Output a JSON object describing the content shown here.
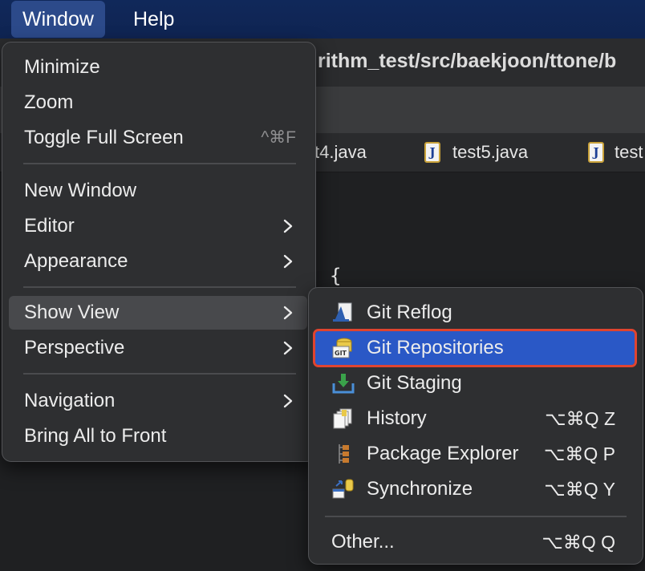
{
  "menubar": {
    "items": [
      {
        "label": "Window"
      },
      {
        "label": "Help"
      }
    ]
  },
  "editor": {
    "path_fragment": "rithm_test/src/baekjoon/ttone/b",
    "tabs": [
      {
        "label": "t4.java"
      },
      {
        "label": "test5.java"
      },
      {
        "label": "test"
      }
    ],
    "code_fragment": "{"
  },
  "window_menu": {
    "items": [
      {
        "label": "Minimize"
      },
      {
        "label": "Zoom"
      },
      {
        "label": "Toggle Full Screen",
        "shortcut": "^⌘F"
      },
      {
        "label": "New Window"
      },
      {
        "label": "Editor"
      },
      {
        "label": "Appearance"
      },
      {
        "label": "Show View"
      },
      {
        "label": "Perspective"
      },
      {
        "label": "Navigation"
      },
      {
        "label": "Bring All to Front"
      }
    ]
  },
  "show_view_menu": {
    "items": [
      {
        "label": "Git Reflog",
        "icon": "git-reflog-icon"
      },
      {
        "label": "Git Repositories",
        "icon": "git-repositories-icon"
      },
      {
        "label": "Git Staging",
        "icon": "git-staging-icon"
      },
      {
        "label": "History",
        "icon": "history-icon",
        "shortcut": "⌥⌘Q Z"
      },
      {
        "label": "Package Explorer",
        "icon": "package-explorer-icon",
        "shortcut": "⌥⌘Q P"
      },
      {
        "label": "Synchronize",
        "icon": "synchronize-icon",
        "shortcut": "⌥⌘Q Y"
      },
      {
        "label": "Other...",
        "shortcut": "⌥⌘Q Q"
      }
    ]
  },
  "colors": {
    "menubar_bg": "#10285a",
    "selection_blue": "#2a58c6",
    "highlight_border": "#e0442f"
  }
}
